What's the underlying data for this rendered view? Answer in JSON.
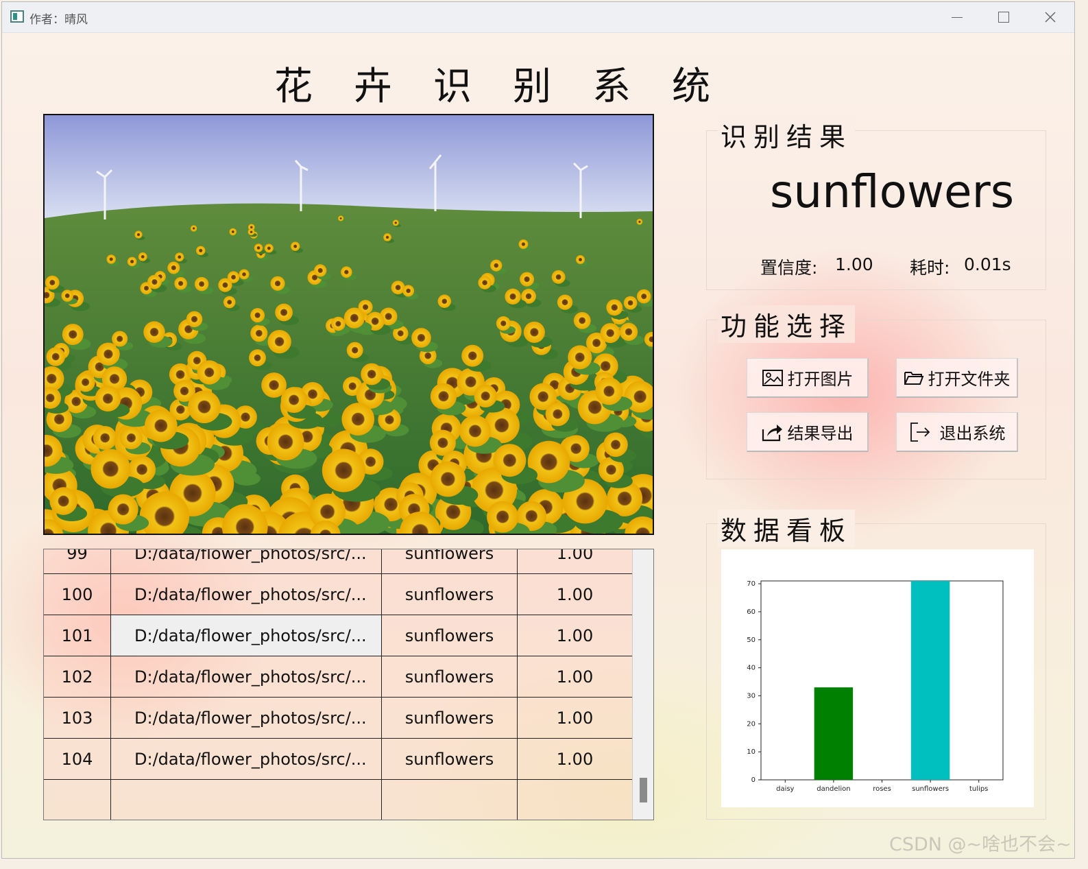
{
  "window": {
    "title": "作者：晴风"
  },
  "app": {
    "title": "花卉识别系统"
  },
  "result": {
    "section_title": "识别结果",
    "label": "sunflowers",
    "confidence_label": "置信度:",
    "confidence_value": "1.00",
    "time_label": "耗时:",
    "time_value": "0.01s"
  },
  "functions": {
    "section_title": "功能选择",
    "open_image": "打开图片",
    "open_folder": "打开文件夹",
    "export": "结果导出",
    "exit": "退出系统"
  },
  "dashboard": {
    "section_title": "数据看板"
  },
  "table": {
    "rows": [
      {
        "idx": "99",
        "path": "D:/data/flower_photos/src/...",
        "cls": "sunflowers",
        "conf": "1.00"
      },
      {
        "idx": "100",
        "path": "D:/data/flower_photos/src/...",
        "cls": "sunflowers",
        "conf": "1.00"
      },
      {
        "idx": "101",
        "path": "D:/data/flower_photos/src/...",
        "cls": "sunflowers",
        "conf": "1.00"
      },
      {
        "idx": "102",
        "path": "D:/data/flower_photos/src/...",
        "cls": "sunflowers",
        "conf": "1.00"
      },
      {
        "idx": "103",
        "path": "D:/data/flower_photos/src/...",
        "cls": "sunflowers",
        "conf": "1.00"
      },
      {
        "idx": "104",
        "path": "D:/data/flower_photos/src/...",
        "cls": "sunflowers",
        "conf": "1.00"
      },
      {
        "idx": "",
        "path": "",
        "cls": "",
        "conf": ""
      }
    ]
  },
  "chart_data": {
    "type": "bar",
    "categories": [
      "daisy",
      "dandelion",
      "roses",
      "sunflowers",
      "tulips"
    ],
    "values": [
      0,
      33,
      0,
      71,
      0
    ],
    "colors": [
      "#1f77b4",
      "#008000",
      "#ff0000",
      "#00bfbf",
      "#bf00bf"
    ],
    "ylim": [
      0,
      71
    ],
    "yticks": [
      0,
      10,
      20,
      30,
      40,
      50,
      60,
      70
    ],
    "title": "",
    "xlabel": "",
    "ylabel": ""
  },
  "watermark": "CSDN @~啥也不会~"
}
